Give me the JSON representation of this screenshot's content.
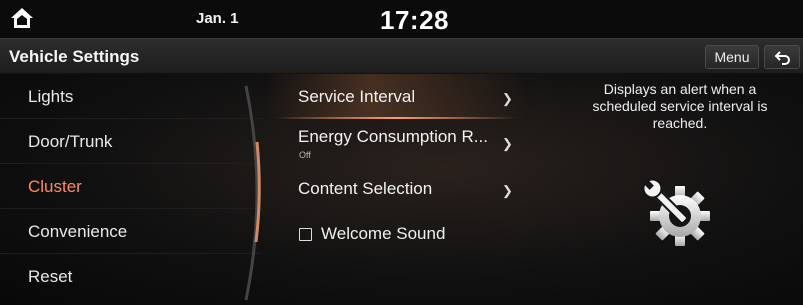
{
  "status_bar": {
    "date": "Jan. 1",
    "time": "17:28",
    "home_icon": "home-icon"
  },
  "header": {
    "title": "Vehicle Settings",
    "menu_label": "Menu",
    "back_icon": "back-arrow-icon"
  },
  "sidebar": {
    "items": [
      {
        "label": "Lights",
        "active": false
      },
      {
        "label": "Door/Trunk",
        "active": false
      },
      {
        "label": "Cluster",
        "active": true
      },
      {
        "label": "Convenience",
        "active": false
      },
      {
        "label": "Reset",
        "active": false
      }
    ],
    "active_color": "#ff8a5c"
  },
  "list": {
    "items": [
      {
        "label": "Service Interval",
        "sub": "",
        "type": "submenu",
        "selected": true
      },
      {
        "label": "Energy Consumption R...",
        "sub": "Off",
        "type": "submenu",
        "selected": false
      },
      {
        "label": "Content Selection",
        "sub": "",
        "type": "submenu",
        "selected": false
      },
      {
        "label": "Welcome Sound",
        "sub": "",
        "type": "checkbox",
        "checked": false
      }
    ]
  },
  "info": {
    "description": "Displays an alert when a scheduled service interval is reached.",
    "icon": "wrench-gear-icon"
  }
}
